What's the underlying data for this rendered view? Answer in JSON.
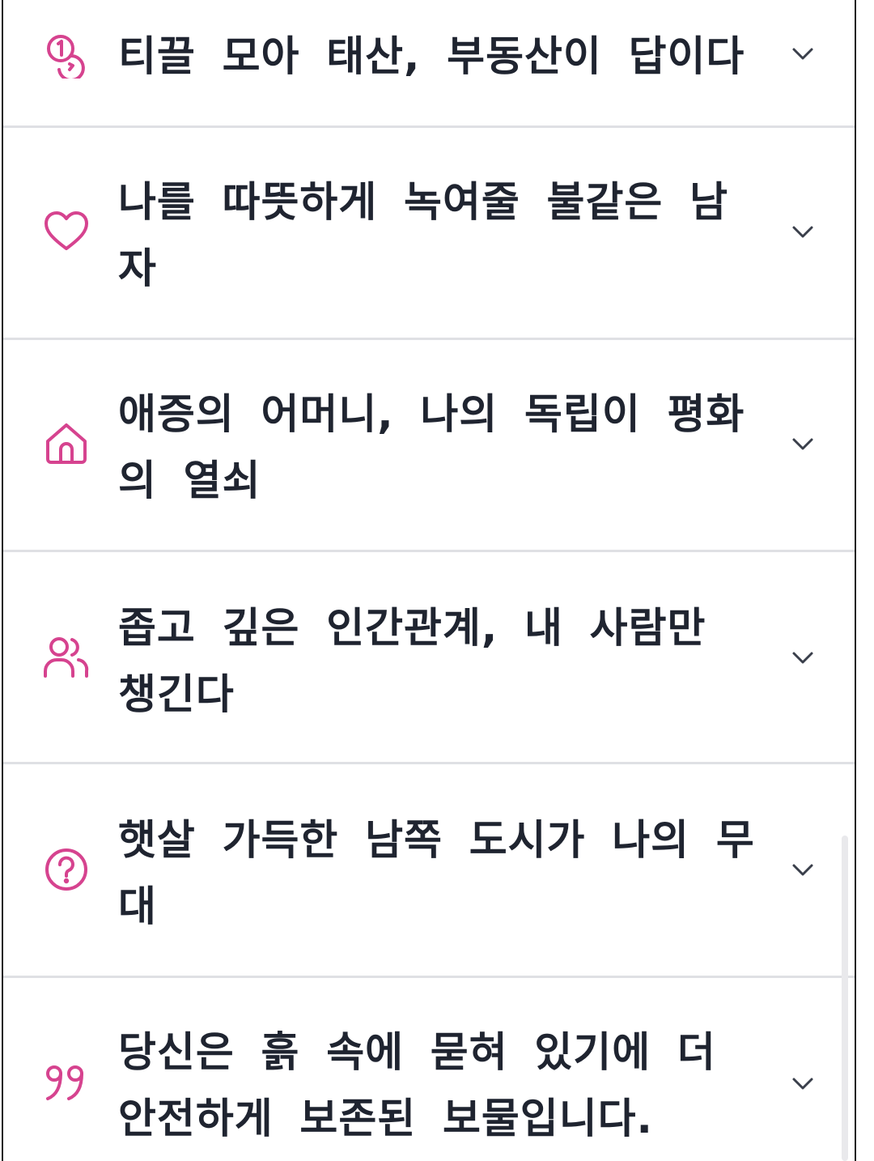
{
  "accent_color": "#d6438f",
  "text_color": "#1f2430",
  "items": [
    {
      "label": "티끌 모아 태산, 부동산이 답이다",
      "icon": "coins-icon"
    },
    {
      "label": "나를 따뜻하게 녹여줄 불같은 남자",
      "icon": "heart-icon"
    },
    {
      "label": "애증의 어머니, 나의 독립이 평화의 열쇠",
      "icon": "home-icon"
    },
    {
      "label": "좁고 깊은 인간관계, 내 사람만 챙긴다",
      "icon": "users-icon"
    },
    {
      "label": "햇살 가득한 남쪽 도시가 나의 무대",
      "icon": "question-circle-icon"
    },
    {
      "label": "당신은 흙 속에 묻혀 있기에 더 안전하게 보존된 보물입니다.",
      "icon": "quote-icon"
    }
  ]
}
